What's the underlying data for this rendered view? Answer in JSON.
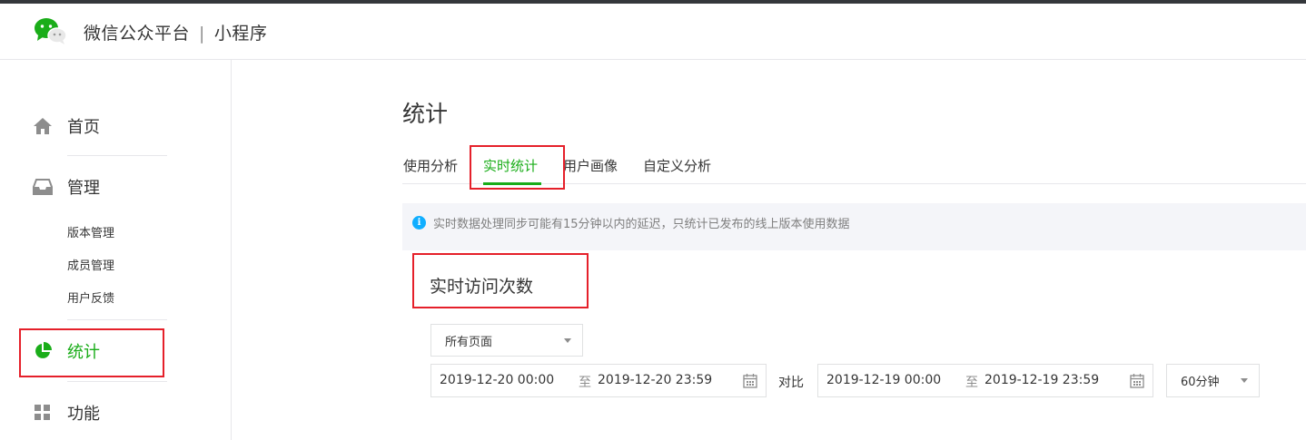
{
  "header": {
    "brand": "微信公众平台",
    "separator": "|",
    "product": "小程序"
  },
  "sidebar": {
    "items": [
      {
        "label": "首页",
        "icon": "home-icon"
      },
      {
        "label": "管理",
        "icon": "inbox-icon"
      },
      {
        "label": "统计",
        "icon": "pie-chart-icon",
        "active": true
      },
      {
        "label": "功能",
        "icon": "grid-icon"
      }
    ],
    "management_subitems": [
      "版本管理",
      "成员管理",
      "用户反馈"
    ]
  },
  "main": {
    "title": "统计",
    "tabs": [
      {
        "label": "使用分析"
      },
      {
        "label": "实时统计",
        "active": true
      },
      {
        "label": "用户画像"
      },
      {
        "label": "自定义分析"
      }
    ],
    "notice": "实时数据处理同步可能有15分钟以内的延迟，只统计已发布的线上版本使用数据",
    "card": {
      "title": "实时访问次数",
      "page_select": "所有页面",
      "range1": {
        "start": "2019-12-20 00:00",
        "to": "至",
        "end": "2019-12-20 23:59"
      },
      "compare_label": "对比",
      "range2": {
        "start": "2019-12-19 00:00",
        "to": "至",
        "end": "2019-12-19 23:59"
      },
      "interval_select": "60分钟"
    }
  },
  "colors": {
    "accent": "#1aad19",
    "highlight_box": "#e5202a",
    "info": "#10aeff"
  }
}
